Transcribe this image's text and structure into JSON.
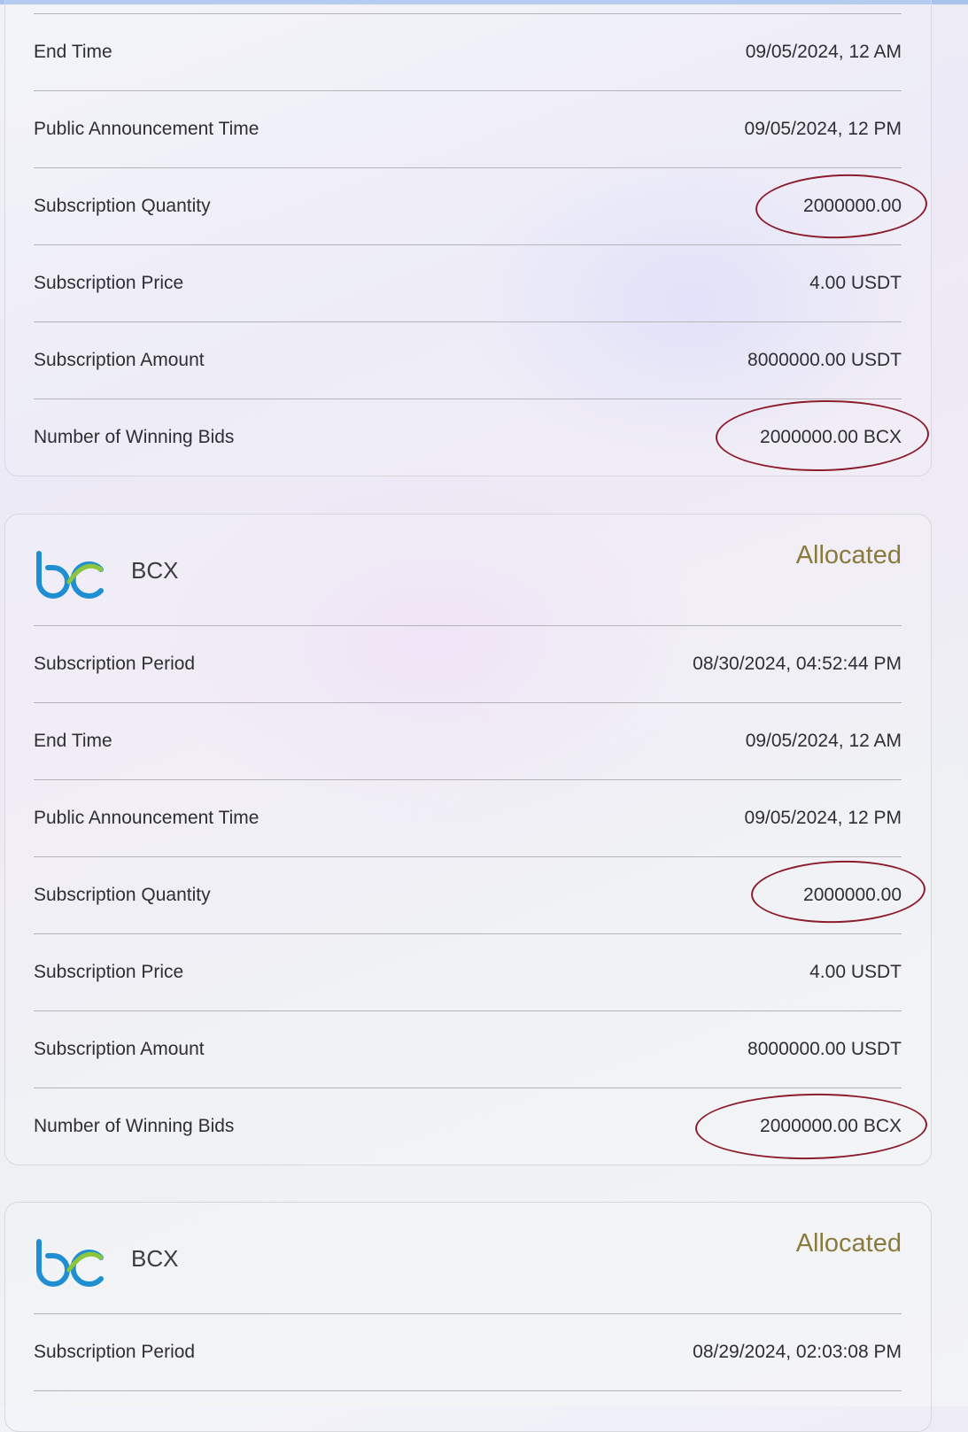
{
  "cards": [
    {
      "rows": [
        {
          "label": "End Time",
          "value": "09/05/2024, 12 AM"
        },
        {
          "label": "Public Announcement Time",
          "value": "09/05/2024, 12 PM"
        },
        {
          "label": "Subscription Quantity",
          "value": "2000000.00"
        },
        {
          "label": "Subscription Price",
          "value": "4.00 USDT"
        },
        {
          "label": "Subscription Amount",
          "value": "8000000.00 USDT"
        },
        {
          "label": "Number of Winning Bids",
          "value": "2000000.00 BCX"
        }
      ]
    },
    {
      "coin": "BCX",
      "status": "Allocated",
      "rows": [
        {
          "label": "Subscription Period",
          "value": "08/30/2024, 04:52:44 PM"
        },
        {
          "label": "End Time",
          "value": "09/05/2024, 12 AM"
        },
        {
          "label": "Public Announcement Time",
          "value": "09/05/2024, 12 PM"
        },
        {
          "label": "Subscription Quantity",
          "value": "2000000.00"
        },
        {
          "label": "Subscription Price",
          "value": "4.00 USDT"
        },
        {
          "label": "Subscription Amount",
          "value": "8000000.00 USDT"
        },
        {
          "label": "Number of Winning Bids",
          "value": "2000000.00 BCX"
        }
      ]
    },
    {
      "coin": "BCX",
      "status": "Allocated",
      "rows": [
        {
          "label": "Subscription Period",
          "value": "08/29/2024, 02:03:08 PM"
        }
      ]
    }
  ],
  "colors": {
    "status": "#8a7a3c",
    "annotation": "#8c1d2c",
    "logo_blue": "#1f8fd1",
    "logo_green": "#8cc63f"
  },
  "icons": {
    "logo": "bcx-logo-icon"
  }
}
